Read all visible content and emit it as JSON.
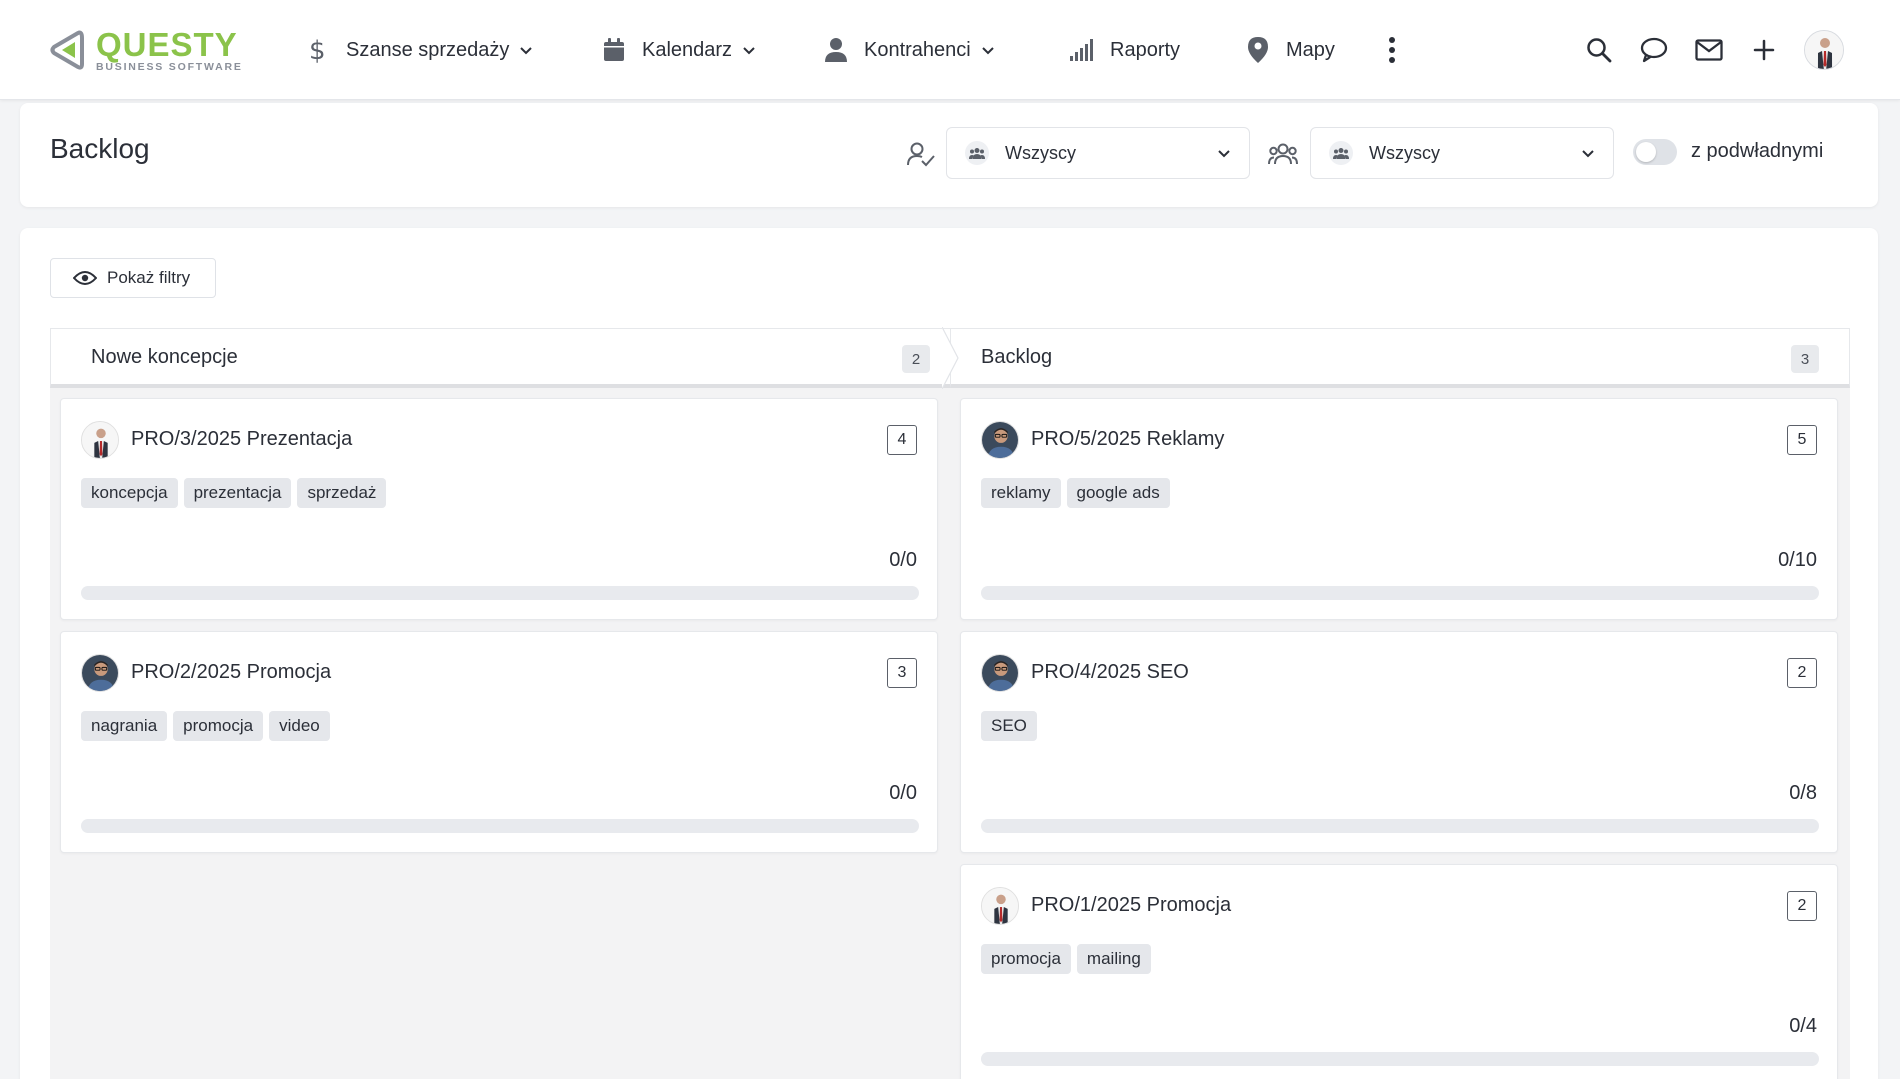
{
  "app": {
    "brand": "QUESTY",
    "brand_sub": "BUSINESS SOFTWARE",
    "accent_color": "#8bc34a"
  },
  "nav": {
    "items": [
      {
        "label": "Szanse sprzedaży",
        "icon": "dollar-icon",
        "dropdown": true
      },
      {
        "label": "Kalendarz",
        "icon": "calendar-icon",
        "dropdown": true
      },
      {
        "label": "Kontrahenci",
        "icon": "person-icon",
        "dropdown": true
      },
      {
        "label": "Raporty",
        "icon": "signal-bars-icon",
        "dropdown": false
      },
      {
        "label": "Mapy",
        "icon": "map-pin-icon",
        "dropdown": false
      }
    ],
    "more_icon": "kebab-menu-icon",
    "right_icons": [
      "search-icon",
      "chat-bubble-icon",
      "mail-icon",
      "plus-icon",
      "user-avatar"
    ]
  },
  "header": {
    "title": "Backlog",
    "assignee_filter": {
      "icon": "person-check-icon",
      "value": "Wszyscy"
    },
    "group_filter": {
      "icon": "group-icon",
      "value": "Wszyscy"
    },
    "subordinates_toggle": {
      "label": "z podwładnymi",
      "on": false
    }
  },
  "main": {
    "show_filters_label": "Pokaż filtry",
    "columns": [
      {
        "title": "Nowe koncepcje",
        "count": "2",
        "cards": [
          {
            "title": "PRO/3/2025 Prezentacja",
            "badge": "4",
            "avatar": "man-in-suit-white-bg",
            "tags": [
              "koncepcja",
              "prezentacja",
              "sprzedaż"
            ],
            "progress_text": "0/0",
            "progress": 0
          },
          {
            "title": "PRO/2/2025 Promocja",
            "badge": "3",
            "avatar": "man-with-glasses-dark-bg",
            "tags": [
              "nagrania",
              "promocja",
              "video"
            ],
            "progress_text": "0/0",
            "progress": 0
          }
        ]
      },
      {
        "title": "Backlog",
        "count": "3",
        "cards": [
          {
            "title": "PRO/5/2025 Reklamy",
            "badge": "5",
            "avatar": "man-with-glasses-dark-bg",
            "tags": [
              "reklamy",
              "google ads"
            ],
            "progress_text": "0/10",
            "progress": 0
          },
          {
            "title": "PRO/4/2025 SEO",
            "badge": "2",
            "avatar": "man-with-glasses-dark-bg",
            "tags": [
              "SEO"
            ],
            "progress_text": "0/8",
            "progress": 0
          },
          {
            "title": "PRO/1/2025 Promocja",
            "badge": "2",
            "avatar": "man-in-suit-white-bg",
            "tags": [
              "promocja",
              "mailing"
            ],
            "progress_text": "0/4",
            "progress": 0
          }
        ]
      }
    ]
  }
}
